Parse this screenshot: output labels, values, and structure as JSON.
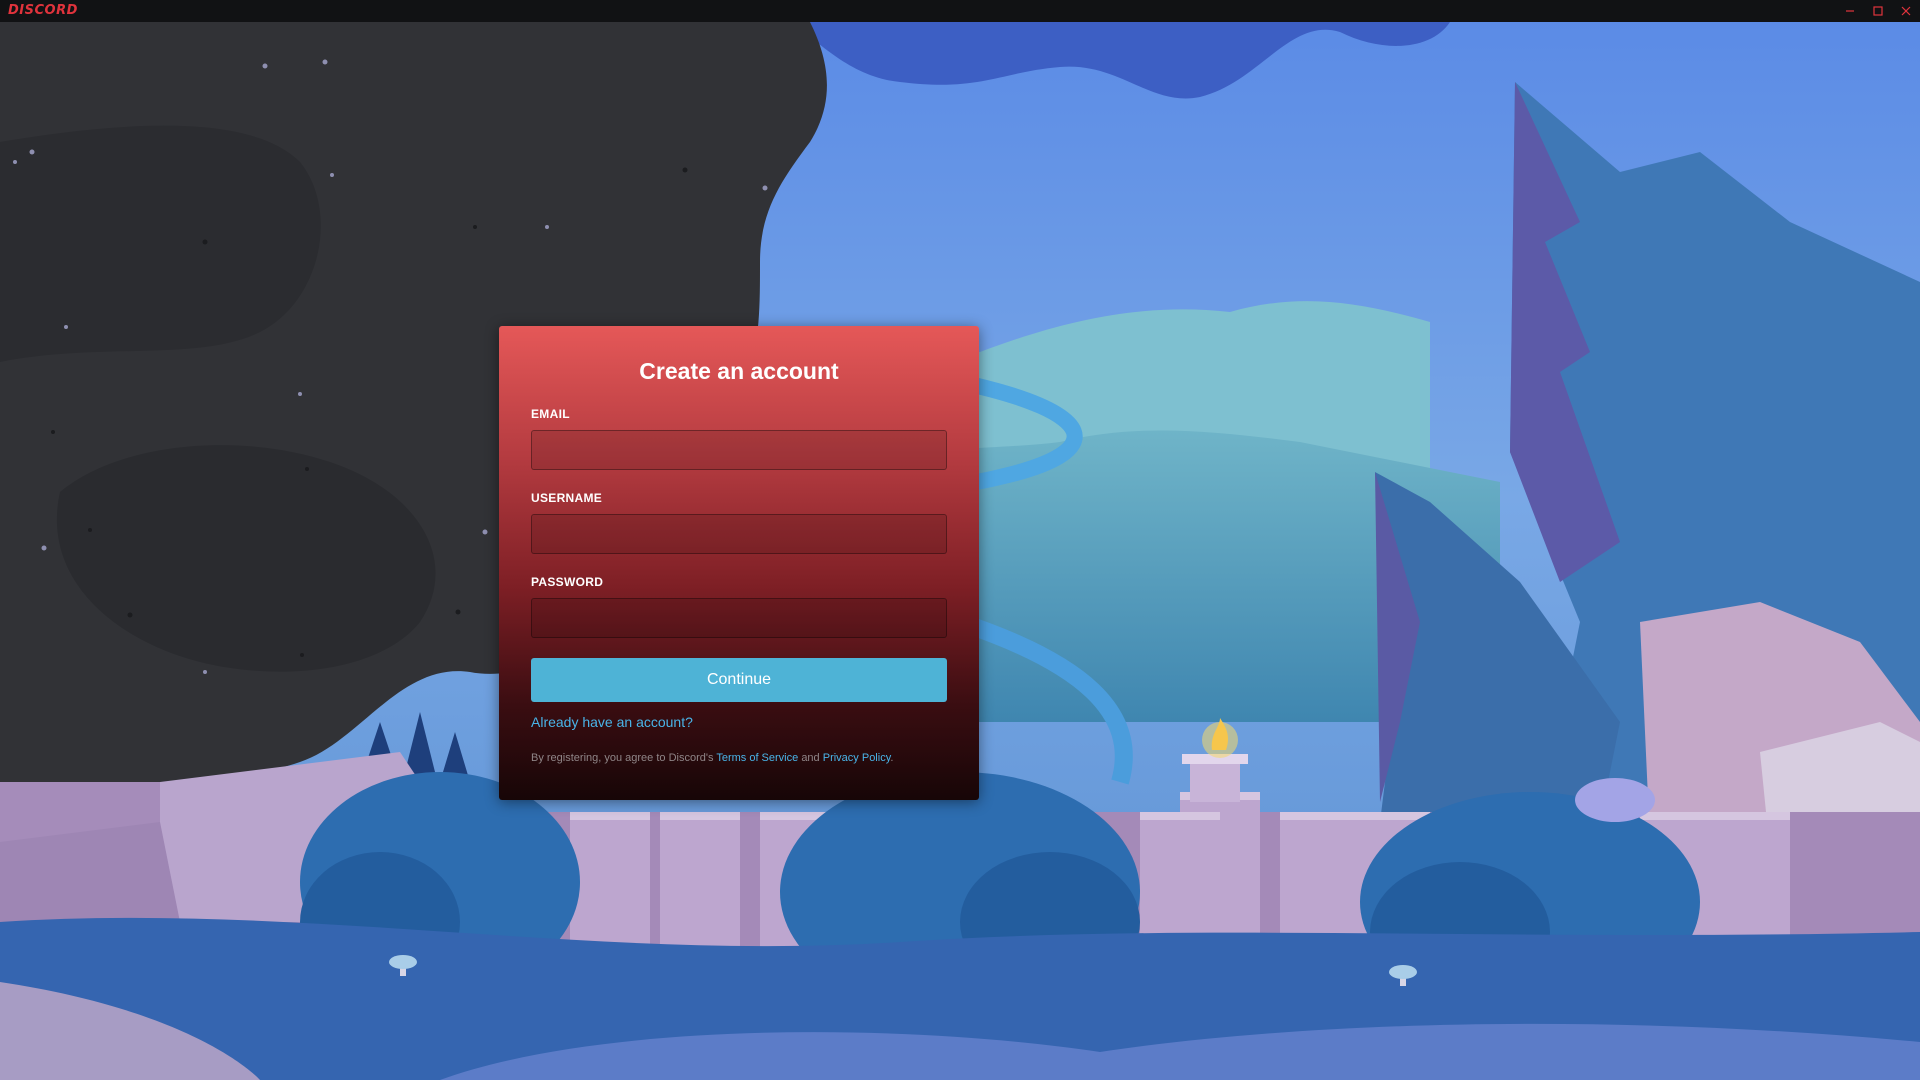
{
  "app": {
    "logo_text": "DISCORD",
    "brand_color": "#e0333c"
  },
  "window_controls": [
    {
      "name": "minimize",
      "icon": "minimize-icon"
    },
    {
      "name": "maximize",
      "icon": "maximize-icon"
    },
    {
      "name": "close",
      "icon": "close-icon"
    }
  ],
  "form": {
    "title": "Create an account",
    "email": {
      "label": "EMAIL",
      "value": "",
      "placeholder": ""
    },
    "username": {
      "label": "USERNAME",
      "value": "",
      "placeholder": ""
    },
    "password": {
      "label": "PASSWORD",
      "value": "",
      "placeholder": ""
    },
    "continue_label": "Continue",
    "login_link": "Already have an account?",
    "legal": {
      "prefix": "By registering, you agree to Discord's",
      "tos_link": "Terms of Service",
      "and": "and",
      "privacy_link": "Privacy Policy",
      "suffix": "."
    }
  },
  "colors": {
    "accent": "#4eb3d6",
    "link": "#49b4e8",
    "card_top": "#e55858",
    "card_bottom": "#170607",
    "titlebar": "#111214"
  }
}
